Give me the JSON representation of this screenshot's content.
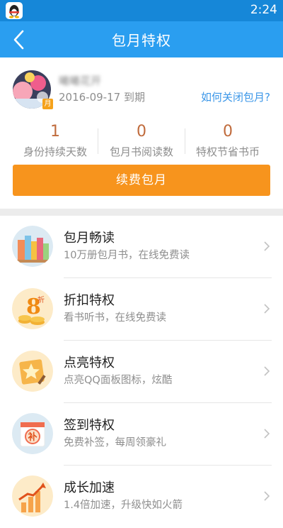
{
  "status_bar": {
    "time": "2:24"
  },
  "header": {
    "title": "包月特权",
    "back_icon": "back-arrow-icon"
  },
  "profile": {
    "username": "曦曦花开",
    "expire_date": "2016-09-17",
    "expire_suffix": "到期",
    "month_badge": "月",
    "close_link": "如何关闭包月?"
  },
  "stats": [
    {
      "value": "1",
      "label": "身份持续天数"
    },
    {
      "value": "0",
      "label": "包月书阅读数"
    },
    {
      "value": "0",
      "label": "特权节省书币"
    }
  ],
  "renew_button": "续费包月",
  "list": [
    {
      "title": "包月畅读",
      "subtitle": "10万册包月书，在线免费读",
      "icon": "books-icon"
    },
    {
      "title": "折扣特权",
      "subtitle": "看书听书，在线免费读",
      "icon": "discount-8-icon",
      "icon_text": "8",
      "icon_small": "折"
    },
    {
      "title": "点亮特权",
      "subtitle": "点亮QQ面板图标，炫酷",
      "icon": "star-book-icon"
    },
    {
      "title": "签到特权",
      "subtitle": "免费补签，每周领豪礼",
      "icon": "calendar-icon",
      "icon_text": "补"
    },
    {
      "title": "成长加速",
      "subtitle": "1.4倍加速，升级快如火箭",
      "icon": "growth-chart-icon"
    }
  ],
  "colors": {
    "header": "#2a9ef0",
    "statusbar": "#1687d8",
    "accent": "#f7941d",
    "link": "#3c97e8"
  }
}
